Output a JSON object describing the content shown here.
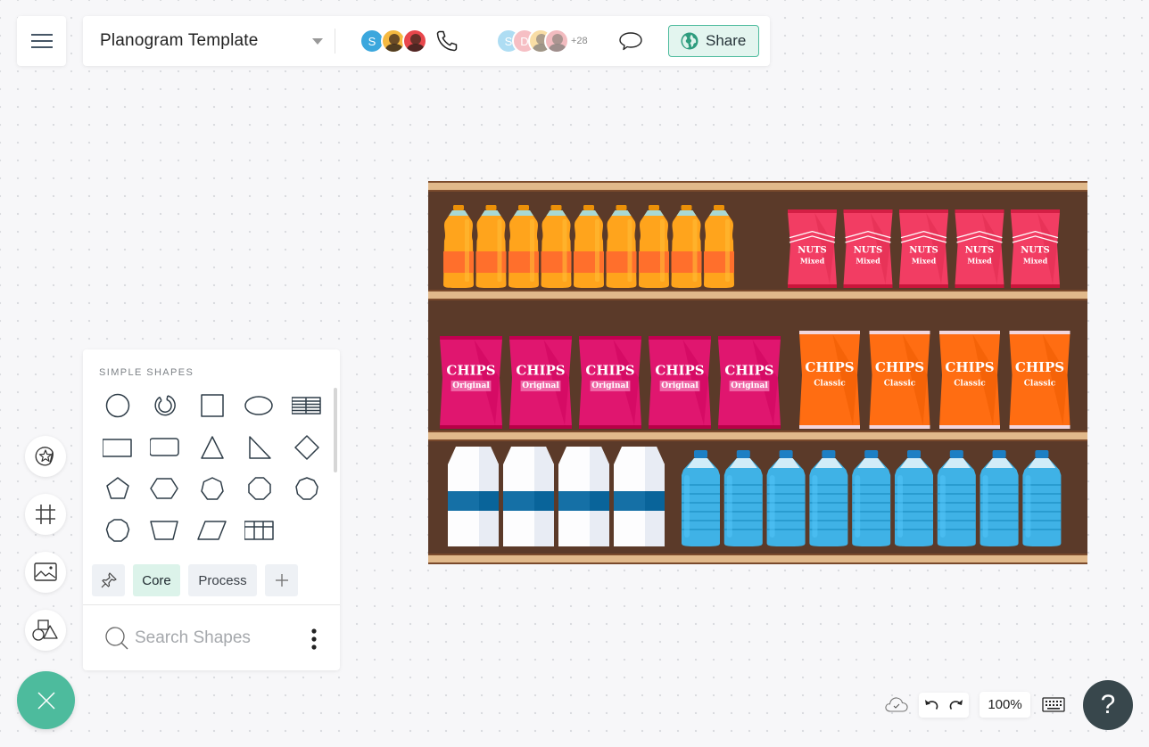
{
  "header": {
    "menu_icon": "hamburger-icon",
    "document_title": "Planogram Template",
    "collaborators_active": [
      {
        "initial": "S",
        "color": "#3ba7dd",
        "type": "initial"
      },
      {
        "initial": "",
        "color": "#f5b940",
        "type": "photo"
      },
      {
        "initial": "",
        "color": "#e8474c",
        "type": "photo"
      }
    ],
    "collaborators_viewing": [
      {
        "initial": "S",
        "color": "#6dc3ea",
        "type": "initial"
      },
      {
        "initial": "D",
        "color": "#f08b95",
        "type": "initial"
      },
      {
        "initial": "",
        "color": "#f5c35c",
        "type": "photo"
      },
      {
        "initial": "",
        "color": "#e8858b",
        "type": "photo"
      }
    ],
    "more_collaborators": "+28",
    "share_label": "Share"
  },
  "planogram": {
    "colors": {
      "back_wall": "#5b3a29",
      "shelf_top": "#e1b98b",
      "shelf_edge": "#7a4a2c"
    },
    "shelves": [
      {
        "groups": [
          {
            "product": "juice-bottle",
            "count": 9,
            "color": "#ffa41c",
            "label_color": "#ff6f2c"
          },
          {
            "product": "snack-bag",
            "count": 5,
            "color": "#f23d63",
            "brand": "NUTS",
            "flavor": "Mixed"
          }
        ]
      },
      {
        "groups": [
          {
            "product": "chips-bag",
            "count": 5,
            "color": "#e0166f",
            "brand": "CHIPS",
            "flavor": "Original"
          },
          {
            "product": "chips-bag",
            "count": 4,
            "color": "#ff6d12",
            "brand": "CHIPS",
            "flavor": "Classic"
          }
        ]
      },
      {
        "groups": [
          {
            "product": "milk-carton",
            "count": 4,
            "color": "#ffffff",
            "band_color": "#1570a6"
          },
          {
            "product": "water-bottle",
            "count": 9,
            "color": "#3fb2e6",
            "cap_color": "#1d7fc4"
          }
        ]
      }
    ]
  },
  "left_rail": {
    "buttons": [
      {
        "name": "templates",
        "icon": "sticker-star-icon"
      },
      {
        "name": "frames",
        "icon": "frame-grid-icon"
      },
      {
        "name": "images",
        "icon": "image-icon"
      },
      {
        "name": "shapes",
        "icon": "shapes-icon"
      }
    ],
    "close_icon": "close-icon"
  },
  "shapes_panel": {
    "section_title": "SIMPLE SHAPES",
    "shapes": [
      "circle",
      "partial-circle",
      "square",
      "ellipse",
      "table-lines",
      "rectangle",
      "rounded-rectangle",
      "triangle",
      "right-triangle",
      "diamond",
      "pentagon",
      "hexagon",
      "heptagon",
      "octagon",
      "nonagon",
      "decagon",
      "trapezoid",
      "parallelogram",
      "table-grid"
    ],
    "tabs": [
      {
        "label": "",
        "icon": "pin-icon",
        "active": false
      },
      {
        "label": "Core",
        "active": true
      },
      {
        "label": "Process",
        "active": false
      },
      {
        "label": "",
        "icon": "plus-icon",
        "active": false
      }
    ],
    "search_placeholder": "Search Shapes",
    "search_value": ""
  },
  "footer": {
    "save_status_icon": "cloud-check-icon",
    "zoom_level": "100%",
    "help_label": "?"
  }
}
